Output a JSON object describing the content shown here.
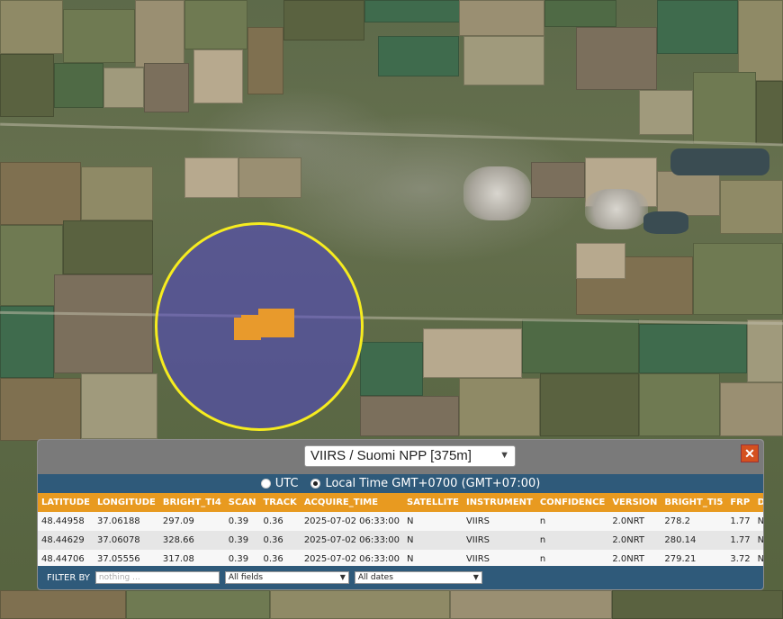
{
  "map": {
    "circle_color": "#f6ec1f",
    "hotspot_color": "#e89a2c"
  },
  "panel": {
    "source_label": "VIIRS / Suomi NPP [375m]",
    "close_icon": "close-icon",
    "time_options": {
      "utc_label": "UTC",
      "local_label": "Local Time GMT+0700 (GMT+07:00)",
      "selected": "local"
    },
    "table": {
      "headers": [
        "LATITUDE",
        "LONGITUDE",
        "BRIGHT_TI4",
        "SCAN",
        "TRACK",
        "ACQUIRE_TIME",
        "SATELLITE",
        "INSTRUMENT",
        "CONFIDENCE",
        "VERSION",
        "BRIGHT_TI5",
        "FRP",
        "DAYNIGHT"
      ],
      "rows": [
        [
          "48.44958",
          "37.06188",
          "297.09",
          "0.39",
          "0.36",
          "2025-07-02 06:33:00",
          "N",
          "VIIRS",
          "n",
          "2.0NRT",
          "278.2",
          "1.77",
          "N"
        ],
        [
          "48.44629",
          "37.06078",
          "328.66",
          "0.39",
          "0.36",
          "2025-07-02 06:33:00",
          "N",
          "VIIRS",
          "n",
          "2.0NRT",
          "280.14",
          "1.77",
          "N"
        ],
        [
          "48.44706",
          "37.05556",
          "317.08",
          "0.39",
          "0.36",
          "2025-07-02 06:33:00",
          "N",
          "VIIRS",
          "n",
          "2.0NRT",
          "279.21",
          "3.72",
          "N"
        ]
      ]
    },
    "filter": {
      "label": "FILTER BY",
      "placeholder": "nothing ...",
      "field_select": "All fields",
      "date_select": "All dates"
    }
  }
}
